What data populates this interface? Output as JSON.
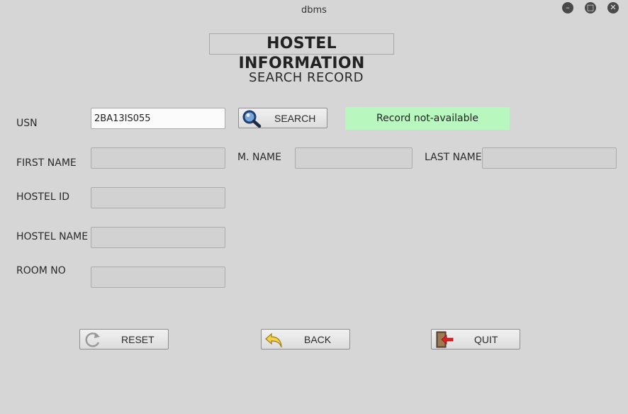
{
  "window": {
    "title": "dbms",
    "minimize_glyph": "–",
    "maximize_glyph": "□",
    "close_glyph": "✕"
  },
  "form": {
    "heading": "HOSTEL INFORMATION",
    "subheading": "SEARCH RECORD"
  },
  "fields": {
    "usn": {
      "label": "USN",
      "value": "2BA13IS055"
    },
    "first_name": {
      "label": "FIRST NAME",
      "value": ""
    },
    "middle_name": {
      "label": "M. NAME",
      "value": ""
    },
    "last_name": {
      "label": "LAST NAME",
      "value": ""
    },
    "hostel_id": {
      "label": "HOSTEL ID",
      "value": ""
    },
    "hostel_name": {
      "label": "HOSTEL NAME",
      "value": ""
    },
    "room_no": {
      "label": "ROOM NO",
      "value": ""
    }
  },
  "buttons": {
    "search": {
      "label": "SEARCH",
      "icon": "magnifier-icon"
    },
    "reset": {
      "label": "RESET",
      "icon": "refresh-icon"
    },
    "back": {
      "label": "BACK",
      "icon": "back-arrow-icon"
    },
    "quit": {
      "label": "QUIT",
      "icon": "exit-door-icon"
    }
  },
  "status": {
    "message": "Record not-available",
    "color": "#b8f8bf"
  }
}
